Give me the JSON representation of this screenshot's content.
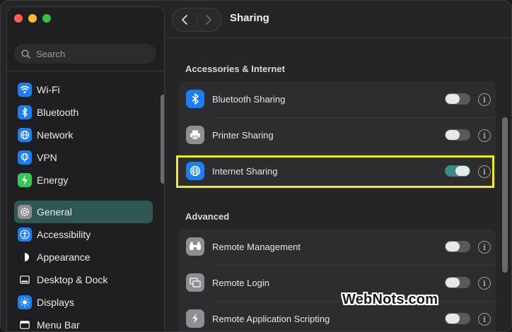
{
  "window": {
    "title": "Sharing"
  },
  "sidebar": {
    "search_placeholder": "Search",
    "items": [
      {
        "label": "Wi-Fi",
        "icon": "wifi-icon",
        "color": "#1a7ff5"
      },
      {
        "label": "Bluetooth",
        "icon": "bluetooth-icon",
        "color": "#1a7ff5"
      },
      {
        "label": "Network",
        "icon": "globe-icon",
        "color": "#1a7ff5"
      },
      {
        "label": "VPN",
        "icon": "vpn-globe-icon",
        "color": "#1a7ff5"
      },
      {
        "label": "Energy",
        "icon": "bolt-icon",
        "color": "#34c759"
      },
      {
        "label": "General",
        "icon": "gear-icon",
        "color": "#8e8e93"
      },
      {
        "label": "Accessibility",
        "icon": "accessibility-icon",
        "color": "#1a7ff5"
      },
      {
        "label": "Appearance",
        "icon": "appearance-icon",
        "color": "#1c1c1e"
      },
      {
        "label": "Desktop & Dock",
        "icon": "dock-icon",
        "color": "#1c1c1e"
      },
      {
        "label": "Displays",
        "icon": "sun-icon",
        "color": "#1a7ff5"
      },
      {
        "label": "Menu Bar",
        "icon": "menubar-icon",
        "color": "#1c1c1e"
      }
    ],
    "active_label": "General"
  },
  "sections": [
    {
      "title": "Accessories & Internet",
      "rows": [
        {
          "label": "Bluetooth Sharing",
          "icon": "bluetooth-icon",
          "enabled": false
        },
        {
          "label": "Printer Sharing",
          "icon": "printer-icon",
          "enabled": false
        },
        {
          "label": "Internet Sharing",
          "icon": "globe-icon",
          "enabled": true
        }
      ]
    },
    {
      "title": "Advanced",
      "rows": [
        {
          "label": "Remote Management",
          "icon": "binoculars-icon",
          "enabled": false
        },
        {
          "label": "Remote Login",
          "icon": "remote-login-icon",
          "enabled": false
        },
        {
          "label": "Remote Application Scripting",
          "icon": "script-icon",
          "enabled": false
        }
      ]
    }
  ],
  "info_glyph": "i",
  "watermark": "WebNots.com",
  "colors": {
    "accent": "#2f5754",
    "toggle_on": "#3b8a83",
    "highlight": "#f0eb2a"
  }
}
